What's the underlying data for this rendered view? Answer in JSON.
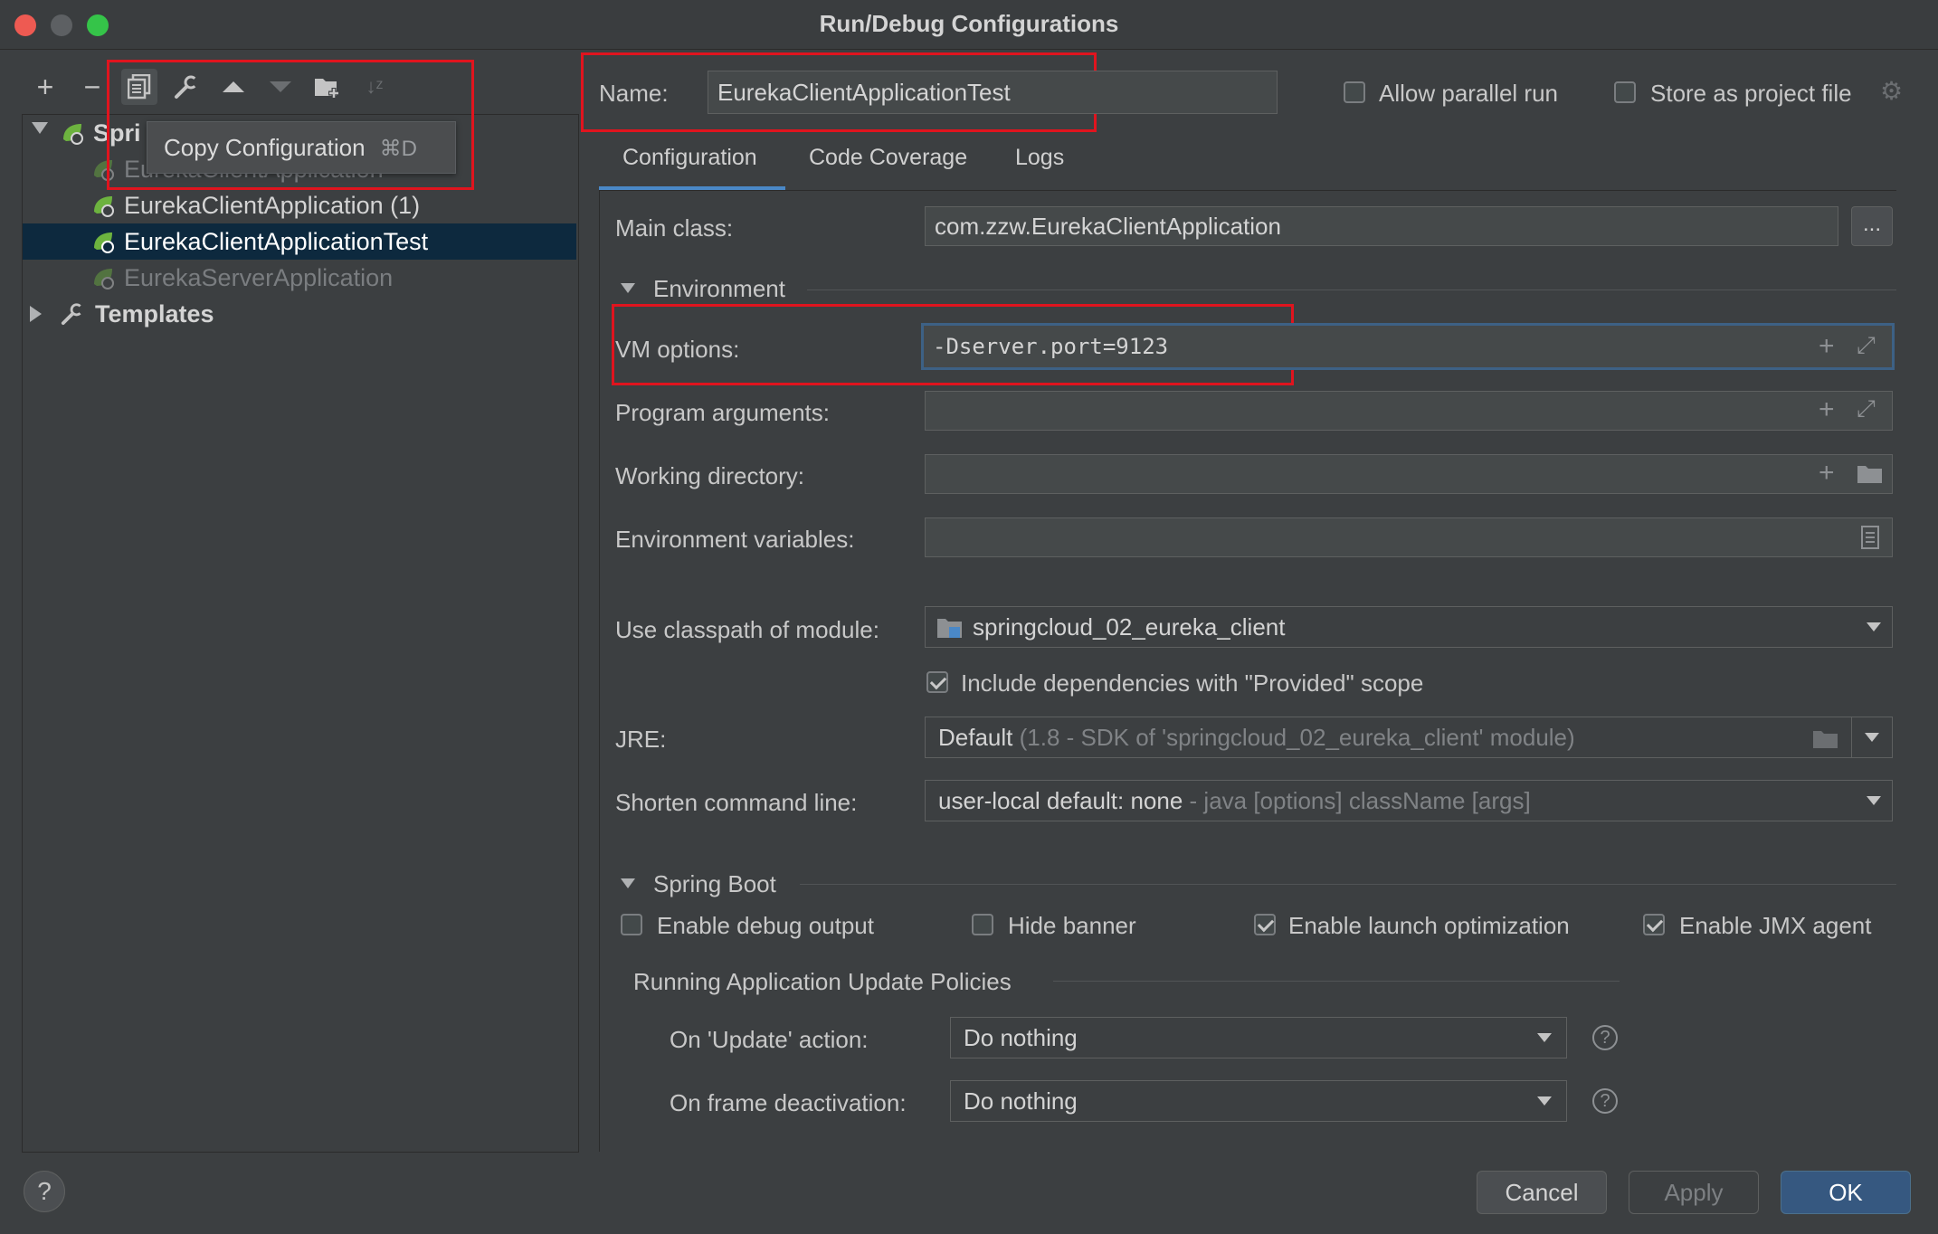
{
  "window": {
    "title": "Run/Debug Configurations"
  },
  "toolbar": {
    "add": "+",
    "remove": "−",
    "copy_tooltip": "Copy Configuration",
    "copy_shortcut": "⌘D"
  },
  "tree": {
    "root_label": "Spri",
    "items": [
      {
        "label": "EurekaClientApplication"
      },
      {
        "label": "EurekaClientApplication (1)"
      },
      {
        "label": "EurekaClientApplicationTest"
      },
      {
        "label": "EurekaServerApplication"
      }
    ],
    "templates_label": "Templates"
  },
  "header": {
    "name_label": "Name:",
    "name_value": "EurekaClientApplicationTest",
    "allow_parallel_label": "Allow parallel run",
    "store_label": "Store as project file"
  },
  "tabs": [
    {
      "label": "Configuration"
    },
    {
      "label": "Code Coverage"
    },
    {
      "label": "Logs"
    }
  ],
  "form": {
    "main_class_label": "Main class:",
    "main_class_value": "com.zzw.EurekaClientApplication",
    "browse_label": "...",
    "environment_label": "Environment",
    "vm_options_label": "VM options:",
    "vm_options_value": "-Dserver.port=9123",
    "program_args_label": "Program arguments:",
    "working_dir_label": "Working directory:",
    "env_vars_label": "Environment variables:",
    "classpath_label": "Use classpath of module:",
    "classpath_value": "springcloud_02_eureka_client",
    "include_deps_label": "Include dependencies with \"Provided\" scope",
    "jre_label": "JRE:",
    "jre_value": "Default",
    "jre_hint": "(1.8 - SDK of 'springcloud_02_eureka_client' module)",
    "shorten_label": "Shorten command line:",
    "shorten_value": "user-local default: none",
    "shorten_hint": "- java [options] className [args]"
  },
  "spring_boot": {
    "section_label": "Spring Boot",
    "enable_debug_label": "Enable debug output",
    "hide_banner_label": "Hide banner",
    "launch_opt_label": "Enable launch optimization",
    "jmx_label": "Enable JMX agent",
    "policies_label": "Running Application Update Policies",
    "update_action_label": "On 'Update' action:",
    "update_action_value": "Do nothing",
    "frame_deact_label": "On frame deactivation:",
    "frame_deact_value": "Do nothing"
  },
  "footer": {
    "help": "?",
    "cancel": "Cancel",
    "apply": "Apply",
    "ok": "OK"
  },
  "colors": {
    "background": "#3c3f41",
    "selection": "#0d293e",
    "accent": "#4a88c7",
    "highlight_box": "#e0141e",
    "ok_button": "#365880"
  }
}
